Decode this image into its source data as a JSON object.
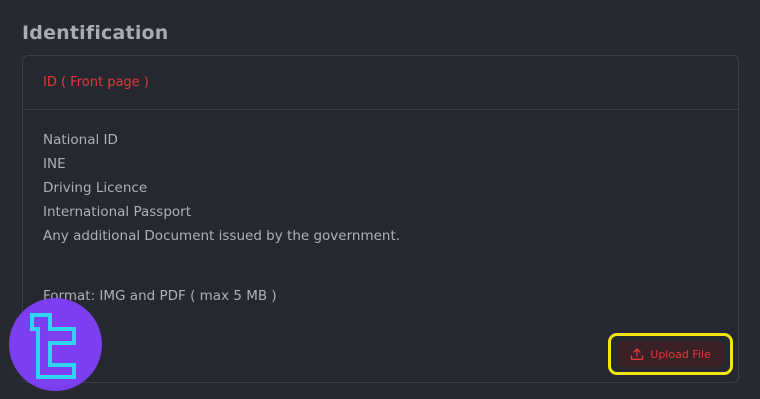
{
  "section": {
    "title": "Identification"
  },
  "card": {
    "header_title": "ID ( Front page )",
    "documents": [
      "National ID",
      "INE",
      "Driving Licence",
      "International Passport",
      "Any additional Document issued by the government."
    ],
    "format_note": "Format: IMG and PDF ( max 5 MB )",
    "upload_label": "Upload File",
    "upload_icon": "upload-icon"
  },
  "logo": {
    "icon": "brand-logo"
  },
  "colors": {
    "background": "#272930",
    "accent_red": "#e5393d",
    "highlight_yellow": "#f5e50f",
    "logo_purple": "#7b3ff0",
    "logo_cyan": "#2fd3f4"
  }
}
